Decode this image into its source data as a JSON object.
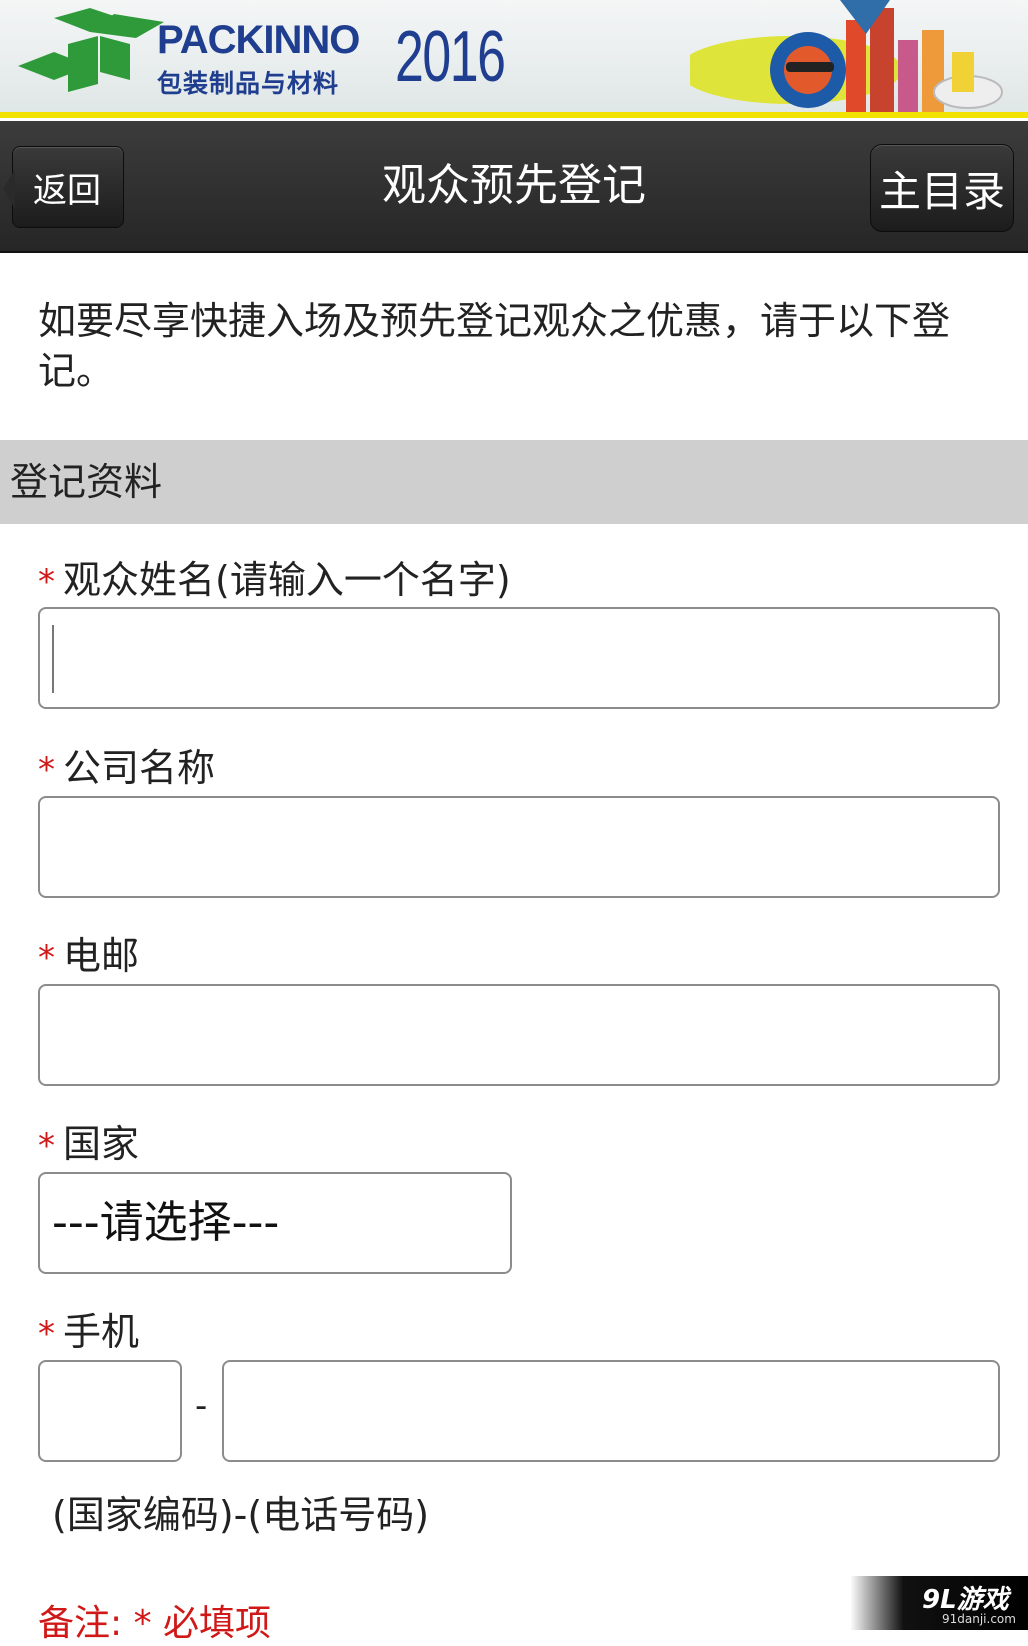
{
  "banner": {
    "brand_name": "PACKINNO",
    "brand_sub": "包装制品与材料",
    "year": "2016",
    "colors": {
      "brand": "#1f3e8f",
      "logo_green": "#2f9a3a",
      "stripe": "#f2e200"
    }
  },
  "navbar": {
    "back_label": "返回",
    "title": "观众预先登记",
    "home_label": "主目录"
  },
  "intro_text": "如要尽享快捷入场及预先登记观众之优惠，请于以下登记。",
  "section_title": "登记资料",
  "form": {
    "required_mark": "*",
    "name_label": "观众姓名(请输入一个名字)",
    "name_value": "",
    "company_label": "公司名称",
    "company_value": "",
    "email_label": "电邮",
    "email_value": "",
    "country_label": "国家",
    "country_selected": "---请选择---",
    "mobile_label": "手机",
    "country_code_value": "",
    "separator": "-",
    "phone_value": "",
    "mobile_hint": "(国家编码)-(电话号码)",
    "note": "备注: * 必填项"
  },
  "watermark": {
    "main": "9L游戏",
    "sub": "91danji.com"
  }
}
